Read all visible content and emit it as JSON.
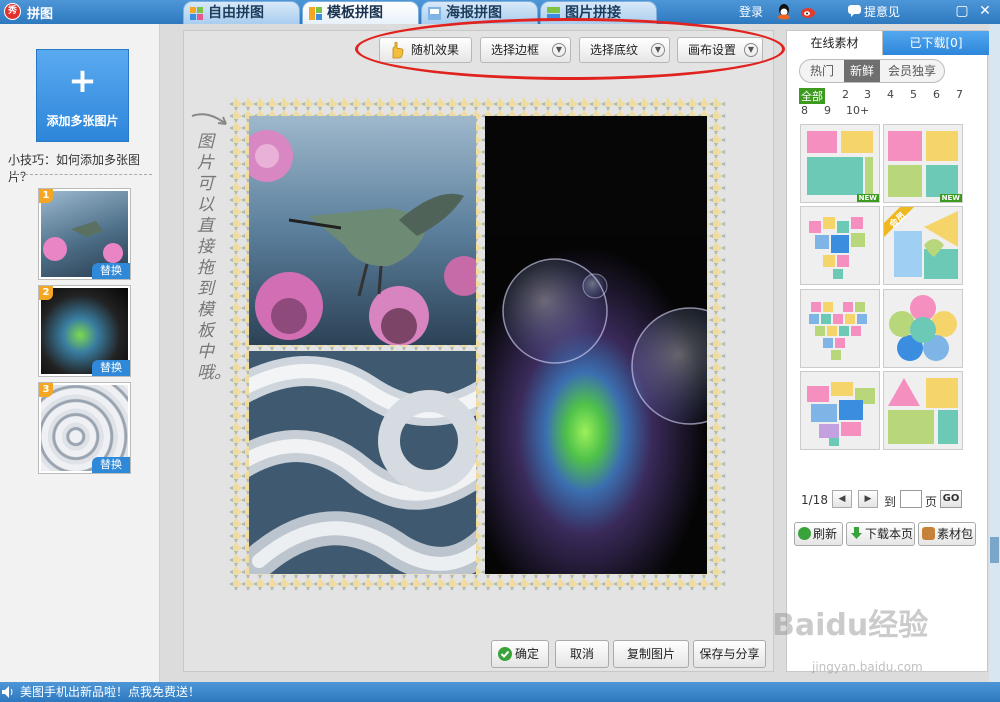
{
  "app": {
    "title": "拼图",
    "logo": "秀"
  },
  "tabs": [
    {
      "label": "自由拼图"
    },
    {
      "label": "模板拼图"
    },
    {
      "label": "海报拼图"
    },
    {
      "label": "图片拼接"
    }
  ],
  "titlebar": {
    "login": "登录",
    "feedback": "提意见"
  },
  "left": {
    "add_label": "添加多张图片",
    "add_plus": "+",
    "tip": "小技巧：如何添加多张图片？",
    "thumbs": [
      {
        "num": "1",
        "replace": "替换"
      },
      {
        "num": "2",
        "replace": "替换"
      },
      {
        "num": "3",
        "replace": "替换"
      }
    ]
  },
  "toolbar": {
    "random": "随机效果",
    "border": "选择边框",
    "texture": "选择底纹",
    "canvas": "画布设置"
  },
  "canvas_hint": "图片可以直接拖到模板中哦。",
  "bottom": {
    "confirm": "确定",
    "cancel": "取消",
    "copy": "复制图片",
    "save": "保存与分享"
  },
  "right": {
    "tab_online": "在线素材",
    "tab_downloaded": "已下载[0]",
    "segments": [
      "热门",
      "新鲜",
      "会员独享"
    ],
    "pages_row1": [
      "全部",
      "2",
      "3",
      "4",
      "5",
      "6",
      "7"
    ],
    "pages_row2": [
      "8",
      "9",
      "10+"
    ],
    "new_badge": "NEW",
    "vip_badge": "会员",
    "pager_text": "1/18",
    "goto": "到",
    "page_unit": "页",
    "go": "GO",
    "refresh": "刷新",
    "download_page": "下载本页",
    "pack": "素材包"
  },
  "status": {
    "message": "美图手机出新品啦！点我免费送！"
  },
  "watermark": {
    "brand": "Baidu经验",
    "url": "jingyan.baidu.com"
  },
  "colors": {
    "accent": "#2e78bf",
    "highlight": "#e0231f",
    "green": "#3c9b1f"
  }
}
